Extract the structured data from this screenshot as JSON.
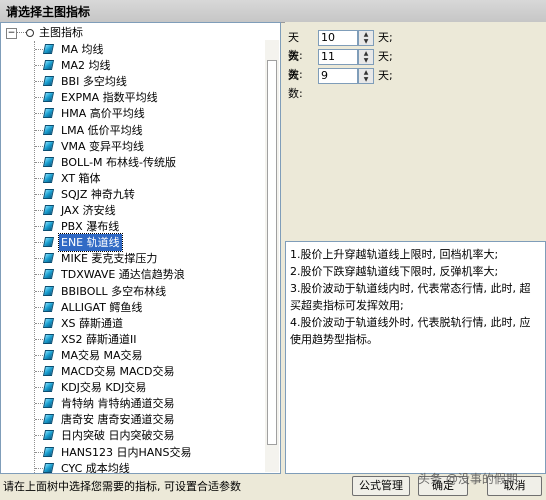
{
  "window": {
    "title": "请选择主图指标"
  },
  "tree": {
    "root_label": "主图指标",
    "items": [
      {
        "label": "MA 均线"
      },
      {
        "label": "MA2 均线"
      },
      {
        "label": "BBI 多空均线"
      },
      {
        "label": "EXPMA 指数平均线"
      },
      {
        "label": "HMA 高价平均线"
      },
      {
        "label": "LMA 低价平均线"
      },
      {
        "label": "VMA 变异平均线"
      },
      {
        "label": "BOLL-M 布林线-传统版"
      },
      {
        "label": "XT 箱体"
      },
      {
        "label": "SQJZ 神奇九转"
      },
      {
        "label": "JAX 济安线"
      },
      {
        "label": "PBX 瀑布线"
      },
      {
        "label": "ENE 轨道线",
        "selected": true
      },
      {
        "label": "MIKE 麦克支撑压力"
      },
      {
        "label": "TDXWAVE 通达信趋势浪"
      },
      {
        "label": "BBIBOLL 多空布林线"
      },
      {
        "label": "ALLIGAT 鳄鱼线"
      },
      {
        "label": "XS 薛斯通道"
      },
      {
        "label": "XS2 薛斯通道II"
      },
      {
        "label": "MA交易 MA交易"
      },
      {
        "label": "MACD交易 MACD交易"
      },
      {
        "label": "KDJ交易 KDJ交易"
      },
      {
        "label": "肯特纳 肯特纳通道交易"
      },
      {
        "label": "唐奇安 唐奇安通道交易"
      },
      {
        "label": "日内突破 日内突破交易"
      },
      {
        "label": "HANS123 日内HANS交易"
      },
      {
        "label": "CYC 成本均线"
      }
    ]
  },
  "params": [
    {
      "label": "天数:",
      "value": "10",
      "unit": "天;"
    },
    {
      "label": "天数:",
      "value": "11",
      "unit": "天;"
    },
    {
      "label": "天数:",
      "value": "9",
      "unit": "天;"
    }
  ],
  "description": [
    "1.股价上升穿越轨道线上限时, 回档机率大;",
    "2.股价下跌穿越轨道线下限时, 反弹机率大;",
    "3.股价波动于轨道线内时, 代表常态行情, 此时, 超买超卖指标可发挥效用;",
    "4.股价波动于轨道线外时, 代表脱轨行情, 此时, 应使用趋势型指标。"
  ],
  "status_text": "请在上面树中选择您需要的指标, 可设置合适参数",
  "buttons": {
    "formula_manage": "公式管理",
    "confirm": "确定",
    "cancel": "取消"
  },
  "watermark": "头条 @没事的假期"
}
